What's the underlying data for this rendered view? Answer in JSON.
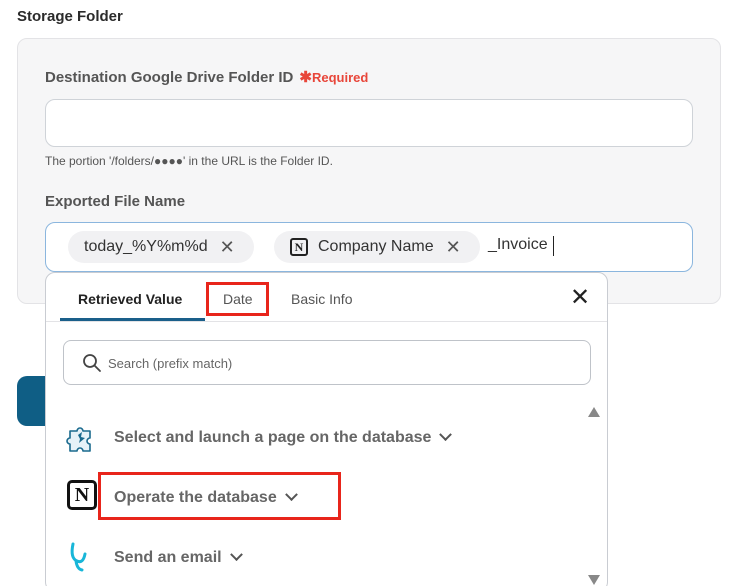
{
  "section": {
    "title": "Storage Folder"
  },
  "folder_field": {
    "label": "Destination Google Drive Folder ID",
    "required_star": "✱",
    "required_label": "Required",
    "value": "",
    "hint": "The portion '/folders/●●●●' in the URL is the Folder ID."
  },
  "file_name_field": {
    "label": "Exported File Name",
    "chips": [
      {
        "label": "today_%Y%m%d",
        "icon": "none"
      },
      {
        "label": "Company Name",
        "icon": "notion-icon"
      }
    ],
    "suffix": "_Invoice"
  },
  "dropdown": {
    "tabs": [
      {
        "label": "Retrieved Value",
        "active": true
      },
      {
        "label": "Date",
        "active": false,
        "highlighted": true
      },
      {
        "label": "Basic Info",
        "active": false
      }
    ],
    "close_icon": "close-icon",
    "search_placeholder": "Search (prefix match)",
    "items": [
      {
        "label": "Select and launch a page on the database",
        "icon": "puzzle-icon"
      },
      {
        "label": "Operate the database",
        "icon": "notion-icon",
        "highlighted": true
      },
      {
        "label": "Send an email",
        "icon": "yoom-mail-icon"
      }
    ]
  },
  "colors": {
    "accent": "#1a5f8a",
    "highlight": "#e8251b",
    "required": "#e8463a",
    "input_focus": "#8bb6de"
  }
}
